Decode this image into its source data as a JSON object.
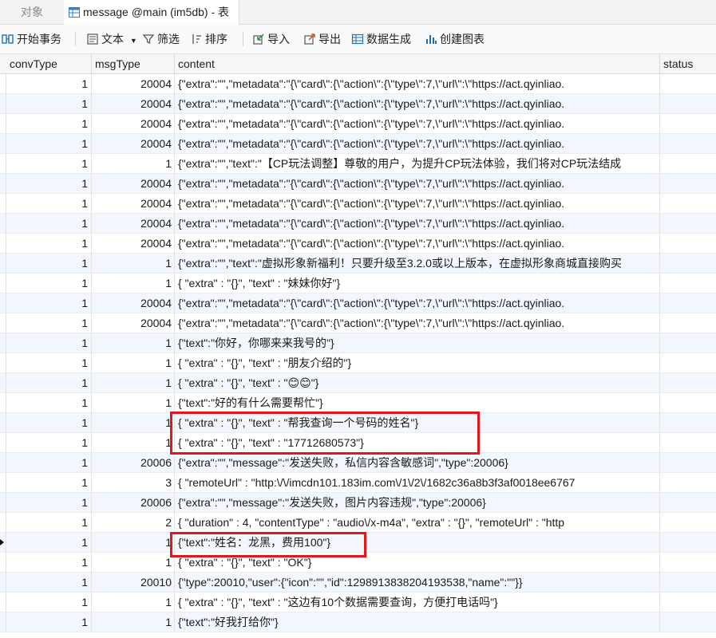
{
  "tabs": {
    "objects_label": "对象",
    "active_label": "message @main (im5db) - 表"
  },
  "toolbar": {
    "begin_transaction": "开始事务",
    "text": "文本",
    "filter": "筛选",
    "sort": "排序",
    "import": "导入",
    "export": "导出",
    "data_generation": "数据生成",
    "create_chart": "创建图表"
  },
  "columns": [
    "convType",
    "msgType",
    "content",
    "status"
  ],
  "rows": [
    {
      "convType": "1",
      "msgType": "20004",
      "content": "{\"extra\":\"\",\"metadata\":\"{\\\"card\\\":{\\\"action\\\":{\\\"type\\\":7,\\\"url\\\":\\\"https://act.qyinliao.",
      "status": ""
    },
    {
      "convType": "1",
      "msgType": "20004",
      "content": "{\"extra\":\"\",\"metadata\":\"{\\\"card\\\":{\\\"action\\\":{\\\"type\\\":7,\\\"url\\\":\\\"https://act.qyinliao.",
      "status": ""
    },
    {
      "convType": "1",
      "msgType": "20004",
      "content": "{\"extra\":\"\",\"metadata\":\"{\\\"card\\\":{\\\"action\\\":{\\\"type\\\":7,\\\"url\\\":\\\"https://act.qyinliao.",
      "status": ""
    },
    {
      "convType": "1",
      "msgType": "20004",
      "content": "{\"extra\":\"\",\"metadata\":\"{\\\"card\\\":{\\\"action\\\":{\\\"type\\\":7,\\\"url\\\":\\\"https://act.qyinliao.",
      "status": ""
    },
    {
      "convType": "1",
      "msgType": "1",
      "content": "{\"extra\":\"\",\"text\":\"【CP玩法调整】尊敬的用户，为提升CP玩法体验，我们将对CP玩法结成",
      "status": ""
    },
    {
      "convType": "1",
      "msgType": "20004",
      "content": "{\"extra\":\"\",\"metadata\":\"{\\\"card\\\":{\\\"action\\\":{\\\"type\\\":7,\\\"url\\\":\\\"https://act.qyinliao.",
      "status": ""
    },
    {
      "convType": "1",
      "msgType": "20004",
      "content": "{\"extra\":\"\",\"metadata\":\"{\\\"card\\\":{\\\"action\\\":{\\\"type\\\":7,\\\"url\\\":\\\"https://act.qyinliao.",
      "status": ""
    },
    {
      "convType": "1",
      "msgType": "20004",
      "content": "{\"extra\":\"\",\"metadata\":\"{\\\"card\\\":{\\\"action\\\":{\\\"type\\\":7,\\\"url\\\":\\\"https://act.qyinliao.",
      "status": ""
    },
    {
      "convType": "1",
      "msgType": "20004",
      "content": "{\"extra\":\"\",\"metadata\":\"{\\\"card\\\":{\\\"action\\\":{\\\"type\\\":7,\\\"url\\\":\\\"https://act.qyinliao.",
      "status": ""
    },
    {
      "convType": "1",
      "msgType": "1",
      "content": "{\"extra\":\"\",\"text\":\"虚拟形象新福利！只要升级至3.2.0或以上版本，在虚拟形象商城直接购买",
      "status": ""
    },
    {
      "convType": "1",
      "msgType": "1",
      "content": "{  \"extra\" : \"{}\",  \"text\" : \"妹妹你好\"}",
      "status": ""
    },
    {
      "convType": "1",
      "msgType": "20004",
      "content": "{\"extra\":\"\",\"metadata\":\"{\\\"card\\\":{\\\"action\\\":{\\\"type\\\":7,\\\"url\\\":\\\"https://act.qyinliao.",
      "status": ""
    },
    {
      "convType": "1",
      "msgType": "20004",
      "content": "{\"extra\":\"\",\"metadata\":\"{\\\"card\\\":{\\\"action\\\":{\\\"type\\\":7,\\\"url\\\":\\\"https://act.qyinliao.",
      "status": ""
    },
    {
      "convType": "1",
      "msgType": "1",
      "content": "{\"text\":\"你好，你哪来来我号的\"}",
      "status": ""
    },
    {
      "convType": "1",
      "msgType": "1",
      "content": "{  \"extra\" : \"{}\",  \"text\" : \"朋友介绍的\"}",
      "status": ""
    },
    {
      "convType": "1",
      "msgType": "1",
      "content": "{  \"extra\" : \"{}\",  \"text\" : \"😊😊\"}",
      "status": ""
    },
    {
      "convType": "1",
      "msgType": "1",
      "content": "{\"text\":\"好的有什么需要帮忙\"}",
      "status": ""
    },
    {
      "convType": "1",
      "msgType": "1",
      "content": "{  \"extra\" : \"{}\",  \"text\" : \"帮我查询一个号码的姓名\"}",
      "status": ""
    },
    {
      "convType": "1",
      "msgType": "1",
      "content": "{  \"extra\" : \"{}\",  \"text\" : \"17712680573\"}",
      "status": ""
    },
    {
      "convType": "1",
      "msgType": "20006",
      "content": "{\"extra\":\"\",\"message\":\"发送失败，私信内容含敏感词\",\"type\":20006}",
      "status": ""
    },
    {
      "convType": "1",
      "msgType": "3",
      "content": "{  \"remoteUrl\" : \"http:\\/\\/imcdn101.183im.com\\/1\\/2\\/1682c36a8b3f3af0018ee6767",
      "status": ""
    },
    {
      "convType": "1",
      "msgType": "20006",
      "content": "{\"extra\":\"\",\"message\":\"发送失败，图片内容违规\",\"type\":20006}",
      "status": ""
    },
    {
      "convType": "1",
      "msgType": "2",
      "content": "{  \"duration\" : 4,  \"contentType\" : \"audio\\/x-m4a\",  \"extra\" : \"{}\",  \"remoteUrl\" : \"http",
      "status": ""
    },
    {
      "convType": "1",
      "msgType": "1",
      "content": "{\"text\":\"姓名：龙黑，费用100\"}",
      "status": ""
    },
    {
      "convType": "1",
      "msgType": "1",
      "content": "{  \"extra\" : \"{}\",  \"text\" : \"OK\"}",
      "status": ""
    },
    {
      "convType": "1",
      "msgType": "20010",
      "content": "{\"type\":20010,\"user\":{\"icon\":\"\",\"id\":1298913838204193538,\"name\":\"\"}}",
      "status": ""
    },
    {
      "convType": "1",
      "msgType": "1",
      "content": "{  \"extra\" : \"{}\",  \"text\" : \"这边有10个数据需要查询，方便打电话吗\"}",
      "status": ""
    },
    {
      "convType": "1",
      "msgType": "1",
      "content": "{\"text\":\"好我打给你\"}",
      "status": ""
    }
  ],
  "current_row_index": 23,
  "colors": {
    "highlight": "#e4161b",
    "alt_row": "#f1f7fd",
    "toolbar_icon": "#1f6fb2"
  }
}
